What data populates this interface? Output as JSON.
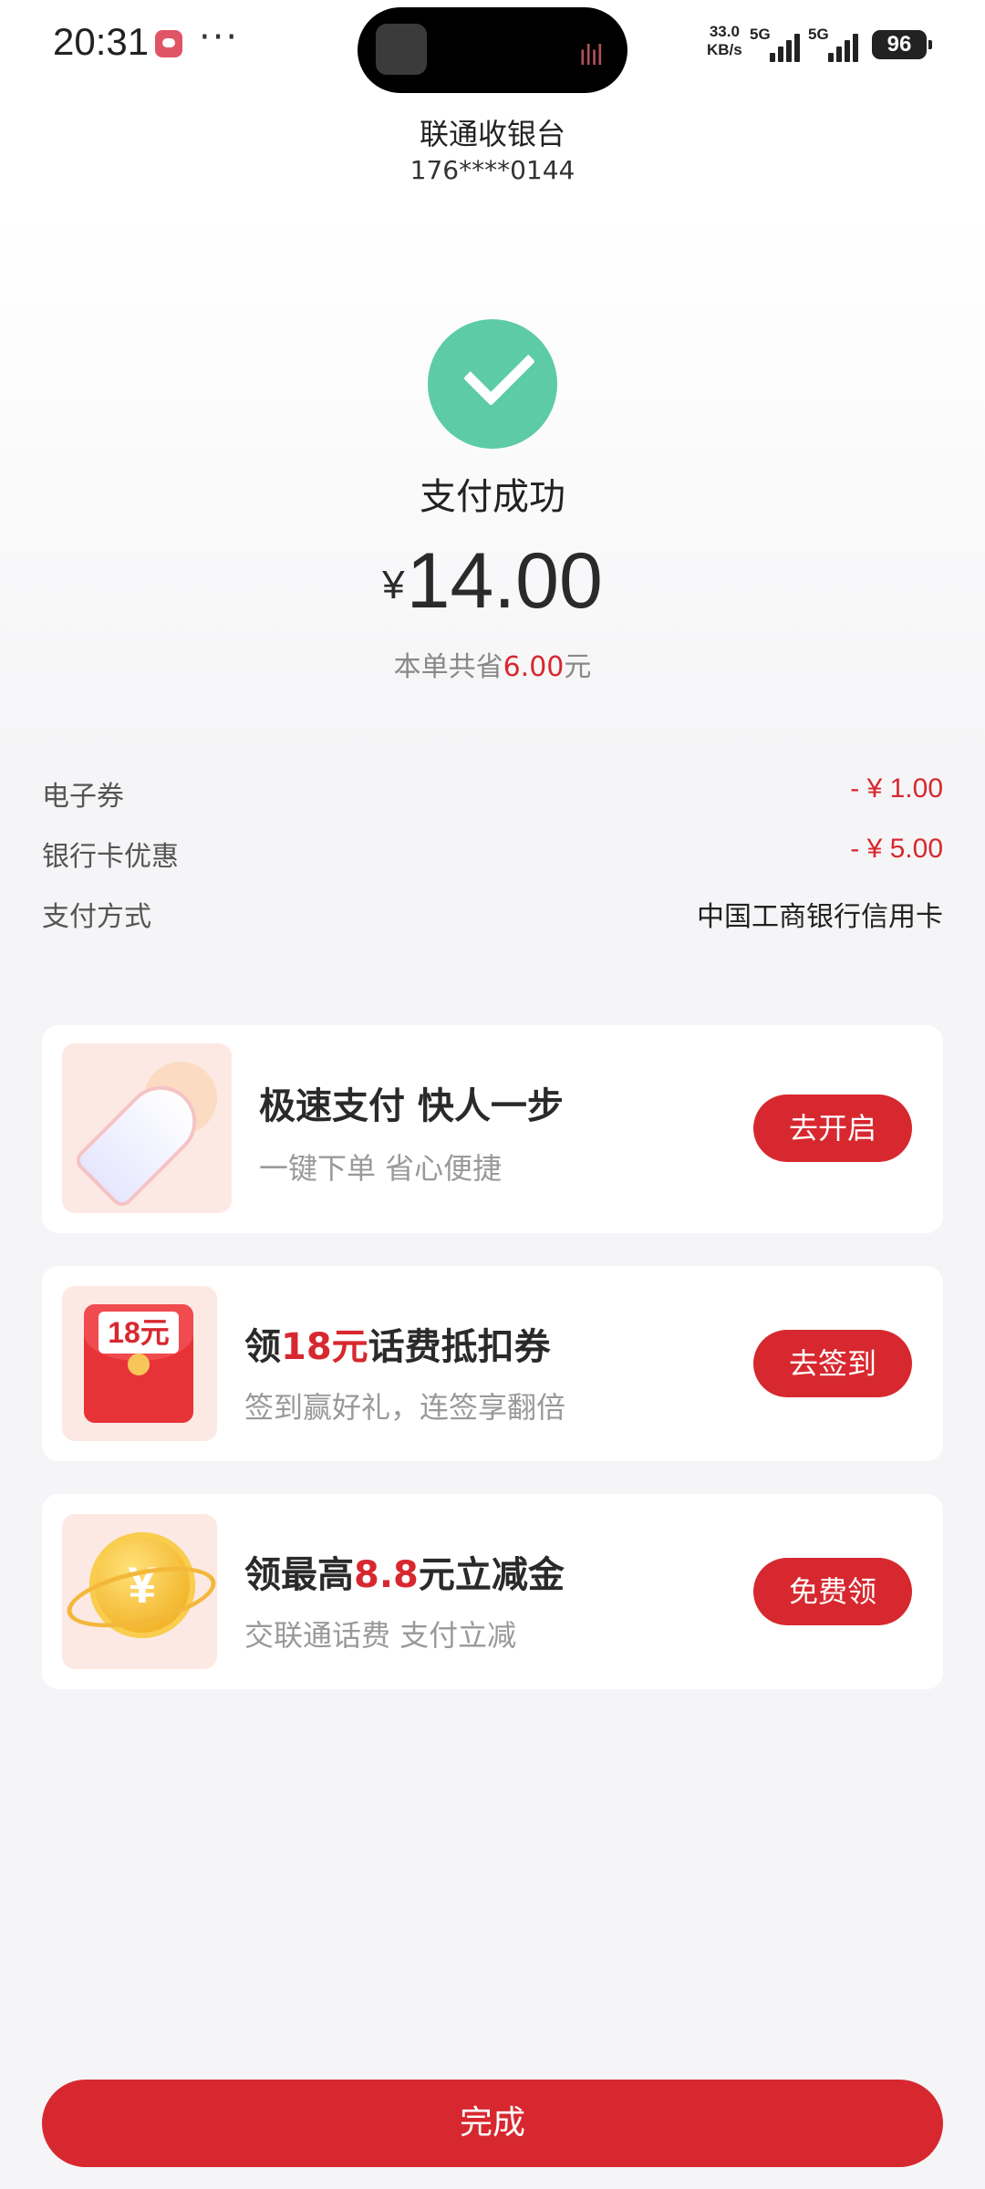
{
  "status_bar": {
    "time": "20:31",
    "more": "···",
    "net_rate_value": "33.0",
    "net_rate_unit": "KB/s",
    "sim1": "5G",
    "sim2": "5G",
    "battery": "96"
  },
  "header": {
    "merchant": "联通收银台",
    "account": "176****0144"
  },
  "result": {
    "status": "支付成功",
    "currency": "¥",
    "amount": "14.00",
    "saving_prefix": "本单共省",
    "saving_value": "6.00",
    "saving_suffix": "元"
  },
  "details": [
    {
      "label": "电子券",
      "value": "- ¥ 1.00"
    },
    {
      "label": "银行卡优惠",
      "value": "- ¥ 5.00"
    },
    {
      "label": "支付方式",
      "value": "中国工商银行信用卡"
    }
  ],
  "promos": [
    {
      "title": "极速支付 快人一步",
      "subtitle": "一键下单 省心便捷",
      "button": "去开启"
    },
    {
      "title_pre": "领",
      "title_red": "18元",
      "title_post": "话费抵扣券",
      "icon_label": "18元",
      "subtitle": "签到赢好礼，连签享翻倍",
      "button": "去签到"
    },
    {
      "title_pre": "领最高",
      "title_red": "8.8",
      "title_post": "元立减金",
      "icon_label": "¥",
      "subtitle": "交联通话费 支付立减",
      "button": "免费领"
    }
  ],
  "done_button": "完成",
  "colors": {
    "accent": "#d7282f",
    "success": "#5dcba6",
    "background": "#f5f5f7"
  }
}
